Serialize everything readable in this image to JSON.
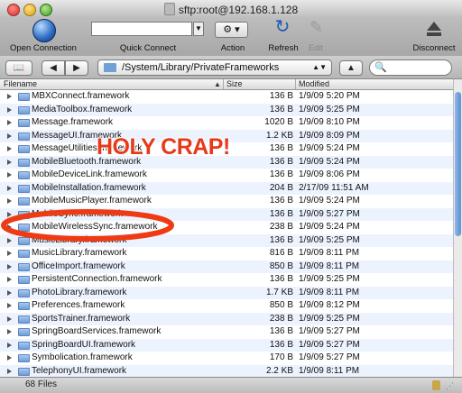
{
  "window": {
    "title": "sftp:root@192.168.1.128"
  },
  "toolbar": {
    "open_connection": "Open Connection",
    "quick_connect": "Quick Connect",
    "action": "Action",
    "refresh": "Refresh",
    "edit": "Edit",
    "disconnect": "Disconnect"
  },
  "pathbar": {
    "path": "/System/Library/PrivateFrameworks"
  },
  "columns": {
    "filename": "Filename",
    "size": "Size",
    "modified": "Modified"
  },
  "files": [
    {
      "name": "MBXConnect.framework",
      "size": "136 B",
      "date": "1/9/09 5:20 PM"
    },
    {
      "name": "MediaToolbox.framework",
      "size": "136 B",
      "date": "1/9/09 5:25 PM"
    },
    {
      "name": "Message.framework",
      "size": "1020 B",
      "date": "1/9/09 8:10 PM"
    },
    {
      "name": "MessageUI.framework",
      "size": "1.2 KB",
      "date": "1/9/09 8:09 PM"
    },
    {
      "name": "MessageUtilities.framework",
      "size": "136 B",
      "date": "1/9/09 5:24 PM"
    },
    {
      "name": "MobileBluetooth.framework",
      "size": "136 B",
      "date": "1/9/09 5:24 PM"
    },
    {
      "name": "MobileDeviceLink.framework",
      "size": "136 B",
      "date": "1/9/09 8:06 PM"
    },
    {
      "name": "MobileInstallation.framework",
      "size": "204 B",
      "date": "2/17/09 11:51 AM"
    },
    {
      "name": "MobileMusicPlayer.framework",
      "size": "136 B",
      "date": "1/9/09 5:24 PM"
    },
    {
      "name": "MobileSync.framework",
      "size": "136 B",
      "date": "1/9/09 5:27 PM"
    },
    {
      "name": "MobileWirelessSync.framework",
      "size": "238 B",
      "date": "1/9/09 5:24 PM"
    },
    {
      "name": "MusicLibrary.framework",
      "size": "136 B",
      "date": "1/9/09 5:25 PM"
    },
    {
      "name": "MusicLibrary.framework",
      "size": "816 B",
      "date": "1/9/09 8:11 PM"
    },
    {
      "name": "OfficeImport.framework",
      "size": "850 B",
      "date": "1/9/09 8:11 PM"
    },
    {
      "name": "PersistentConnection.framework",
      "size": "136 B",
      "date": "1/9/09 5:25 PM"
    },
    {
      "name": "PhotoLibrary.framework",
      "size": "1.7 KB",
      "date": "1/9/09 8:11 PM"
    },
    {
      "name": "Preferences.framework",
      "size": "850 B",
      "date": "1/9/09 8:12 PM"
    },
    {
      "name": "SportsTrainer.framework",
      "size": "238 B",
      "date": "1/9/09 5:25 PM"
    },
    {
      "name": "SpringBoardServices.framework",
      "size": "136 B",
      "date": "1/9/09 5:27 PM"
    },
    {
      "name": "SpringBoardUI.framework",
      "size": "136 B",
      "date": "1/9/09 5:27 PM"
    },
    {
      "name": "Symbolication.framework",
      "size": "170 B",
      "date": "1/9/09 5:27 PM"
    },
    {
      "name": "TelephonyUI.framework",
      "size": "2.2 KB",
      "date": "1/9/09 8:11 PM"
    }
  ],
  "status": {
    "count": "68 Files"
  },
  "annotation": {
    "text": "HOLY CRAP!"
  }
}
